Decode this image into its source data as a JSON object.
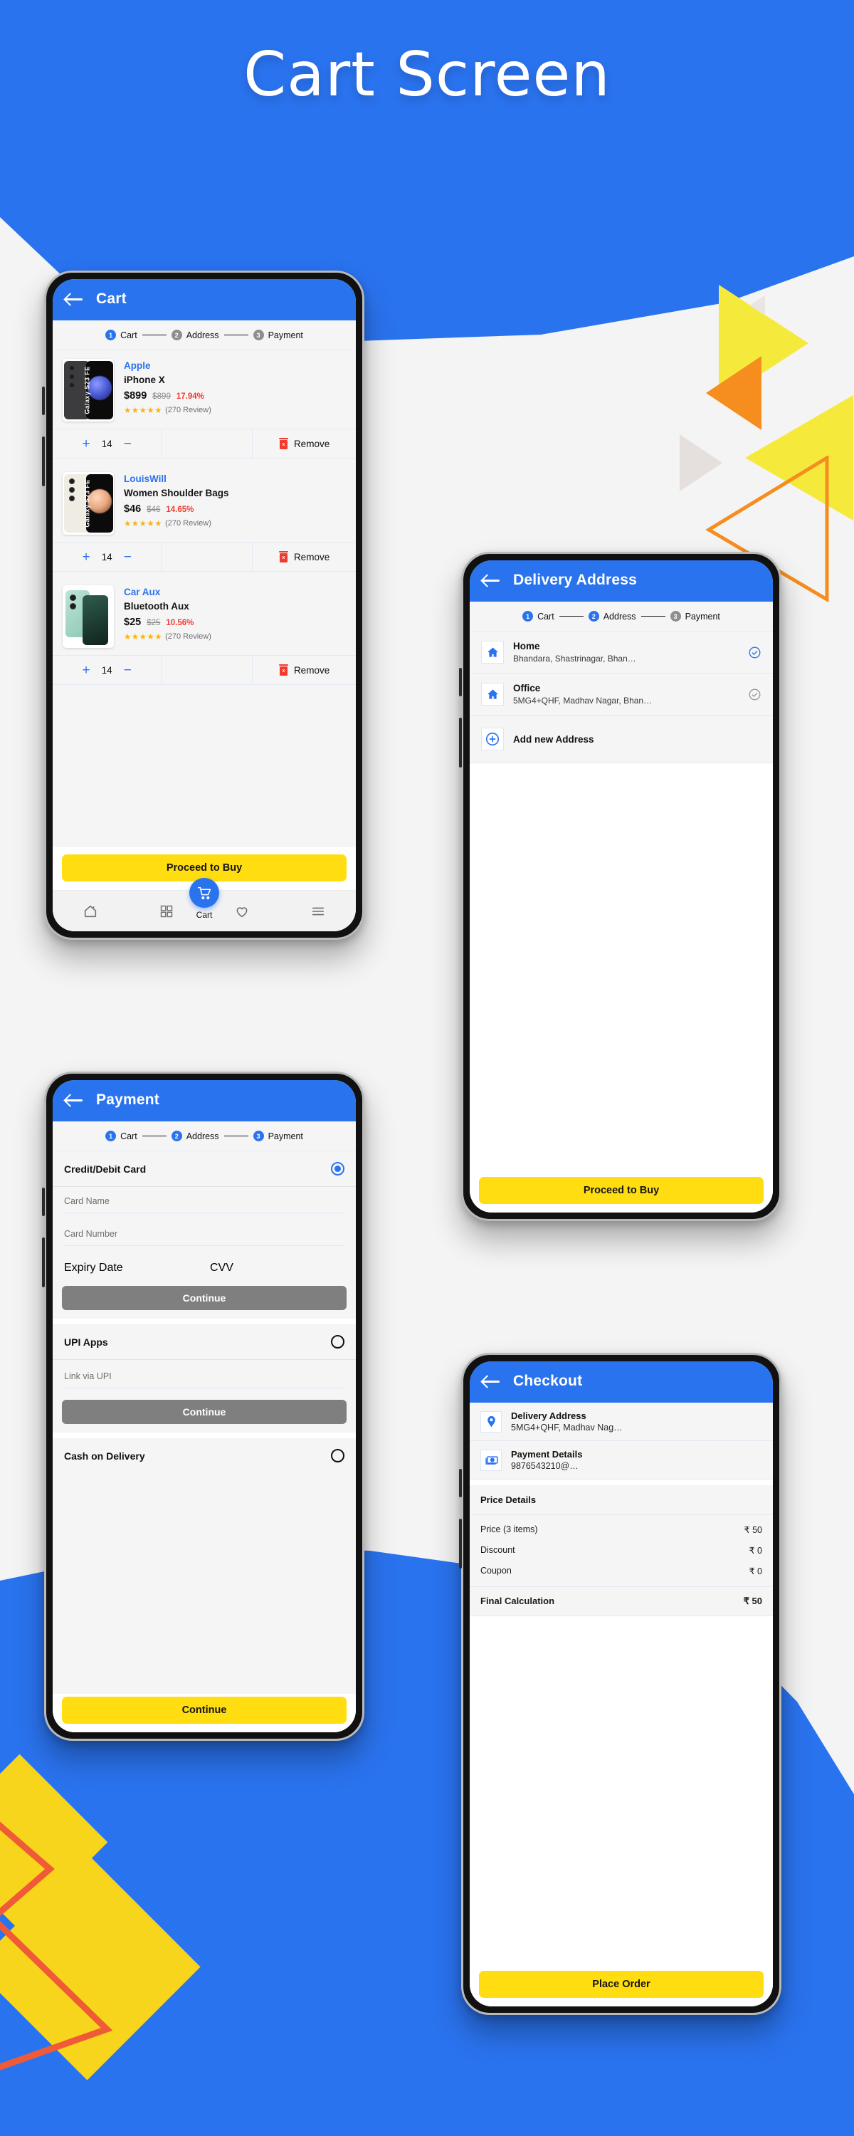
{
  "page": {
    "title": "Cart Screen",
    "colors": {
      "brand_blue": "#2a73ef",
      "accent_yellow": "#ffdd10",
      "decor_yellow": "#f7d51d",
      "decor_orange": "#f68d1f",
      "danger_red": "#f23a2f",
      "star_amber": "#fbb212",
      "disabled_grey": "#7f7f7f"
    }
  },
  "stepper": {
    "steps": [
      {
        "num": "1",
        "label": "Cart"
      },
      {
        "num": "2",
        "label": "Address"
      },
      {
        "num": "3",
        "label": "Payment"
      }
    ]
  },
  "cart_screen": {
    "appbar": {
      "title": "Cart",
      "back_icon": "back-arrow-icon"
    },
    "items": [
      {
        "brand": "Apple",
        "name": "iPhone X",
        "price": "$899",
        "mrp": "$899",
        "discount": "17.94%",
        "stars": "★★★★★",
        "reviews": "(270 Review)",
        "qty": "14",
        "plus": "+",
        "minus": "−",
        "remove_label": "Remove",
        "thumb_label": "Galaxy S23 FE",
        "thumb_back_color": "#3c3c3e",
        "thumb_orb_color": "#4a5bd6"
      },
      {
        "brand": "LouisWill",
        "name": "Women Shoulder Bags",
        "price": "$46",
        "mrp": "$46",
        "discount": "14.65%",
        "stars": "★★★★★",
        "reviews": "(270 Review)",
        "qty": "14",
        "plus": "+",
        "minus": "−",
        "remove_label": "Remove",
        "thumb_label": "Galaxy S23 FE",
        "thumb_back_color": "#efece3",
        "thumb_orb_color": "#e8a780"
      },
      {
        "brand": "Car Aux",
        "name": "Bluetooth Aux",
        "price": "$25",
        "mrp": "$25",
        "discount": "10.56%",
        "stars": "★★★★★",
        "reviews": "(270 Review)",
        "qty": "14",
        "plus": "+",
        "minus": "−",
        "remove_label": "Remove",
        "thumb_label": "",
        "thumb_back_color": "#a8d8c8",
        "thumb_orb_color": "#1d4b3e"
      }
    ],
    "cta": "Proceed to Buy",
    "bottom_nav": {
      "home_icon": "home-icon",
      "grid_icon": "grid-icon",
      "cart_icon": "shopping-cart-icon",
      "cart_label": "Cart",
      "wishlist_icon": "heart-icon",
      "menu_icon": "hamburger-menu-icon"
    }
  },
  "address_screen": {
    "appbar": {
      "title": "Delivery Address",
      "back_icon": "back-arrow-icon"
    },
    "addresses": [
      {
        "icon": "home-icon",
        "title": "Home",
        "subtitle": "Bhandara, Shastrinagar, Bhan…",
        "selected": true
      },
      {
        "icon": "home-icon",
        "title": "Office",
        "subtitle": "5MG4+QHF, Madhav Nagar, Bhan…",
        "selected": false
      }
    ],
    "add_new": {
      "icon": "plus-circle-icon",
      "label": "Add new Address"
    },
    "cta": "Proceed to Buy"
  },
  "payment_screen": {
    "appbar": {
      "title": "Payment",
      "back_icon": "back-arrow-icon"
    },
    "methods": [
      {
        "label": "Credit/Debit Card",
        "selected": true,
        "fields": [
          {
            "placeholder": "Card Name"
          },
          {
            "placeholder": "Card Number"
          }
        ],
        "fields_row": [
          {
            "placeholder": "Expiry Date"
          },
          {
            "placeholder": "CVV"
          }
        ],
        "continue_label": "Continue",
        "continue_style": "disabled"
      },
      {
        "label": "UPI Apps",
        "selected": false,
        "fields": [
          {
            "placeholder": "Link via UPI"
          }
        ],
        "continue_label": "Continue",
        "continue_style": "disabled"
      },
      {
        "label": "Cash on Delivery",
        "selected": false,
        "continue_label": "Continue",
        "continue_style": "primary"
      }
    ]
  },
  "checkout_screen": {
    "appbar": {
      "title": "Checkout",
      "back_icon": "back-arrow-icon"
    },
    "summary": [
      {
        "icon": "location-pin-icon",
        "title": "Delivery Address",
        "value": "5MG4+QHF, Madhav Nag…"
      },
      {
        "icon": "money-icon",
        "title": "Payment Details",
        "value": "9876543210@…"
      }
    ],
    "price_details": {
      "heading": "Price Details",
      "rows": [
        {
          "label": "Price (3 items)",
          "value": "₹ 50"
        },
        {
          "label": "Discount",
          "value": "₹ 0"
        },
        {
          "label": "Coupon",
          "value": "₹ 0"
        }
      ],
      "total": {
        "label": "Final Calculation",
        "value": "₹ 50"
      }
    },
    "cta": "Place Order"
  }
}
